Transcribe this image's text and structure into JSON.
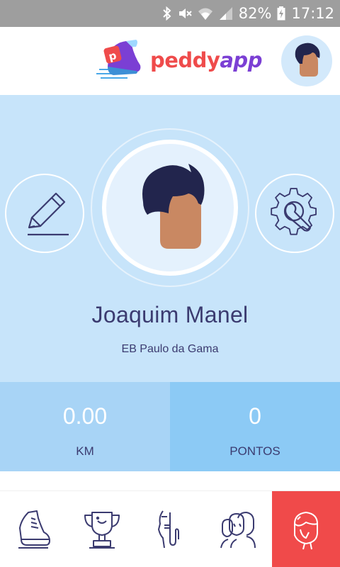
{
  "status_bar": {
    "battery": "82%",
    "time": "17:12",
    "icons": [
      "bluetooth-icon",
      "mute-icon",
      "wifi-icon",
      "signal-icon",
      "battery-charging-icon"
    ]
  },
  "header": {
    "logo_primary": "peddy",
    "logo_secondary": "app",
    "logo_icon": "sneaker-logo-icon",
    "avatar_icon": "user-avatar-icon"
  },
  "profile": {
    "name": "Joaquim Manel",
    "school": "EB Paulo da Gama",
    "edit_icon": "pencil-icon",
    "settings_icon": "gear-wrench-icon"
  },
  "stats": {
    "distance_value": "0.00",
    "distance_label": "KM",
    "points_value": "0",
    "points_label": "PONTOS"
  },
  "bottom_nav": {
    "items": [
      {
        "icon": "walking-shoe-icon",
        "active": false
      },
      {
        "icon": "trophy-icon",
        "active": false
      },
      {
        "icon": "quiet-gesture-icon",
        "active": false
      },
      {
        "icon": "group-icon",
        "active": false
      },
      {
        "icon": "profile-icon",
        "active": true
      }
    ]
  },
  "colors": {
    "brand_red": "#ef4b4b",
    "brand_purple": "#7b3fd4",
    "profile_bg": "#c7e4fa",
    "stat_km_bg": "#a8d4f6",
    "stat_points_bg": "#8ccaf5",
    "text_dark": "#3b3b70",
    "active_tab": "#f04a4a"
  }
}
